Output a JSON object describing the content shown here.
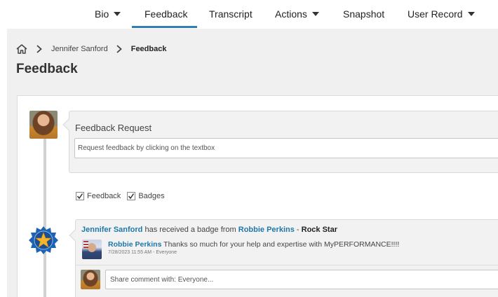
{
  "nav": {
    "items": [
      {
        "label": "Bio",
        "has_dropdown": true
      },
      {
        "label": "Feedback",
        "has_dropdown": false,
        "active": true
      },
      {
        "label": "Transcript",
        "has_dropdown": false
      },
      {
        "label": "Actions",
        "has_dropdown": true
      },
      {
        "label": "Snapshot",
        "has_dropdown": false
      },
      {
        "label": "User Record",
        "has_dropdown": true
      }
    ],
    "active_color": "#2f7fb5"
  },
  "breadcrumb": {
    "home_icon": "home-icon",
    "separator_icon": "chevron-right-icon",
    "items": [
      "Jennifer Sanford",
      "Feedback"
    ]
  },
  "page": {
    "title": "Feedback"
  },
  "feedback_request": {
    "title": "Feedback Request",
    "placeholder": "Request feedback by clicking on the textbox"
  },
  "filters": [
    {
      "label": "Feedback",
      "checked": true
    },
    {
      "label": "Badges",
      "checked": true
    }
  ],
  "badge_post": {
    "icon": "star-badge-icon",
    "recipient": "Jennifer Sanford",
    "action_text": " has received a badge from ",
    "giver": "Robbie Perkins",
    "separator": " - ",
    "badge_name": "Rock Star",
    "comment": {
      "author": "Robbie Perkins",
      "text": " Thanks so much for your help and expertise with MyPERFORMANCE!!!!",
      "timestamp": "7/28/2023 11:55 AM",
      "meta_separator": " - ",
      "visibility": "Everyone"
    },
    "share_placeholder": "Share comment with: Everyone..."
  },
  "colors": {
    "link": "#1f78a8",
    "page_bg": "#f0f0f0",
    "card_bg": "#f2f2f2"
  }
}
